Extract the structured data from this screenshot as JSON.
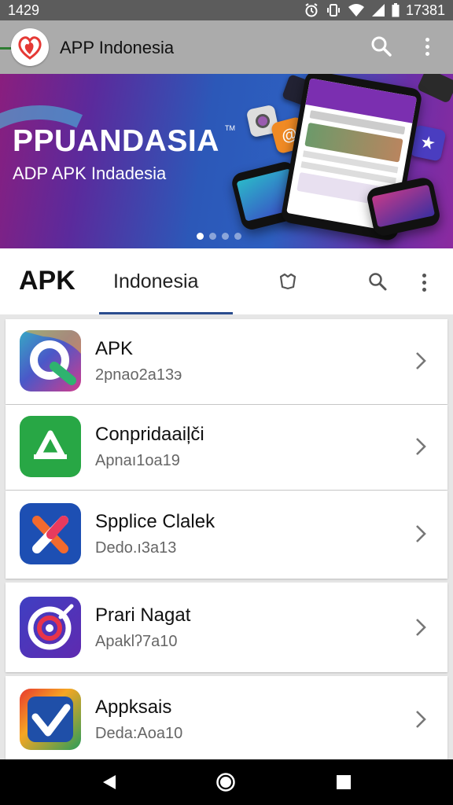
{
  "status_bar": {
    "time": "1429",
    "clock_right": "17381",
    "icons": [
      "alarm-icon",
      "vibrate-icon",
      "wifi-icon",
      "signal-icon",
      "battery-icon"
    ]
  },
  "app_bar": {
    "title": "APP Indonesia",
    "icons": [
      "app-logo",
      "search-icon",
      "more-vert-icon"
    ]
  },
  "banner": {
    "title": "PPUANDASIA",
    "trademark": "TM",
    "subtitle": "ADP APK Indadesia",
    "pager": {
      "count": 4,
      "active": 0
    }
  },
  "tabs": {
    "brand": "APK",
    "active_tab": "Indonesia",
    "icons": [
      "shield-icon",
      "search-icon",
      "more-vert-icon"
    ]
  },
  "apps": [
    {
      "name": "APK",
      "subtitle": "2pnao2a13э",
      "icon": "q-app-icon"
    },
    {
      "name": "Conpridaaiļči",
      "subtitle": "Apnaı1oa19",
      "icon": "a-app-icon"
    },
    {
      "name": "Spplice Clalek",
      "subtitle": "Dedo.ı3a13",
      "icon": "x-app-icon"
    },
    {
      "name": "Prari Nagat",
      "subtitle": "Apaklʔ7a10",
      "icon": "target-app-icon"
    },
    {
      "name": "Appksais",
      "subtitle": "Deda:Aoa10",
      "icon": "check-app-icon"
    }
  ],
  "nav_bar": {
    "icons": [
      "back-icon",
      "home-icon",
      "recents-icon"
    ]
  },
  "colors": {
    "status_bar": "#5c5c5c",
    "app_bar": "#ababab",
    "tab_underline": "#2a4c8e",
    "nav_bar": "#000000"
  }
}
